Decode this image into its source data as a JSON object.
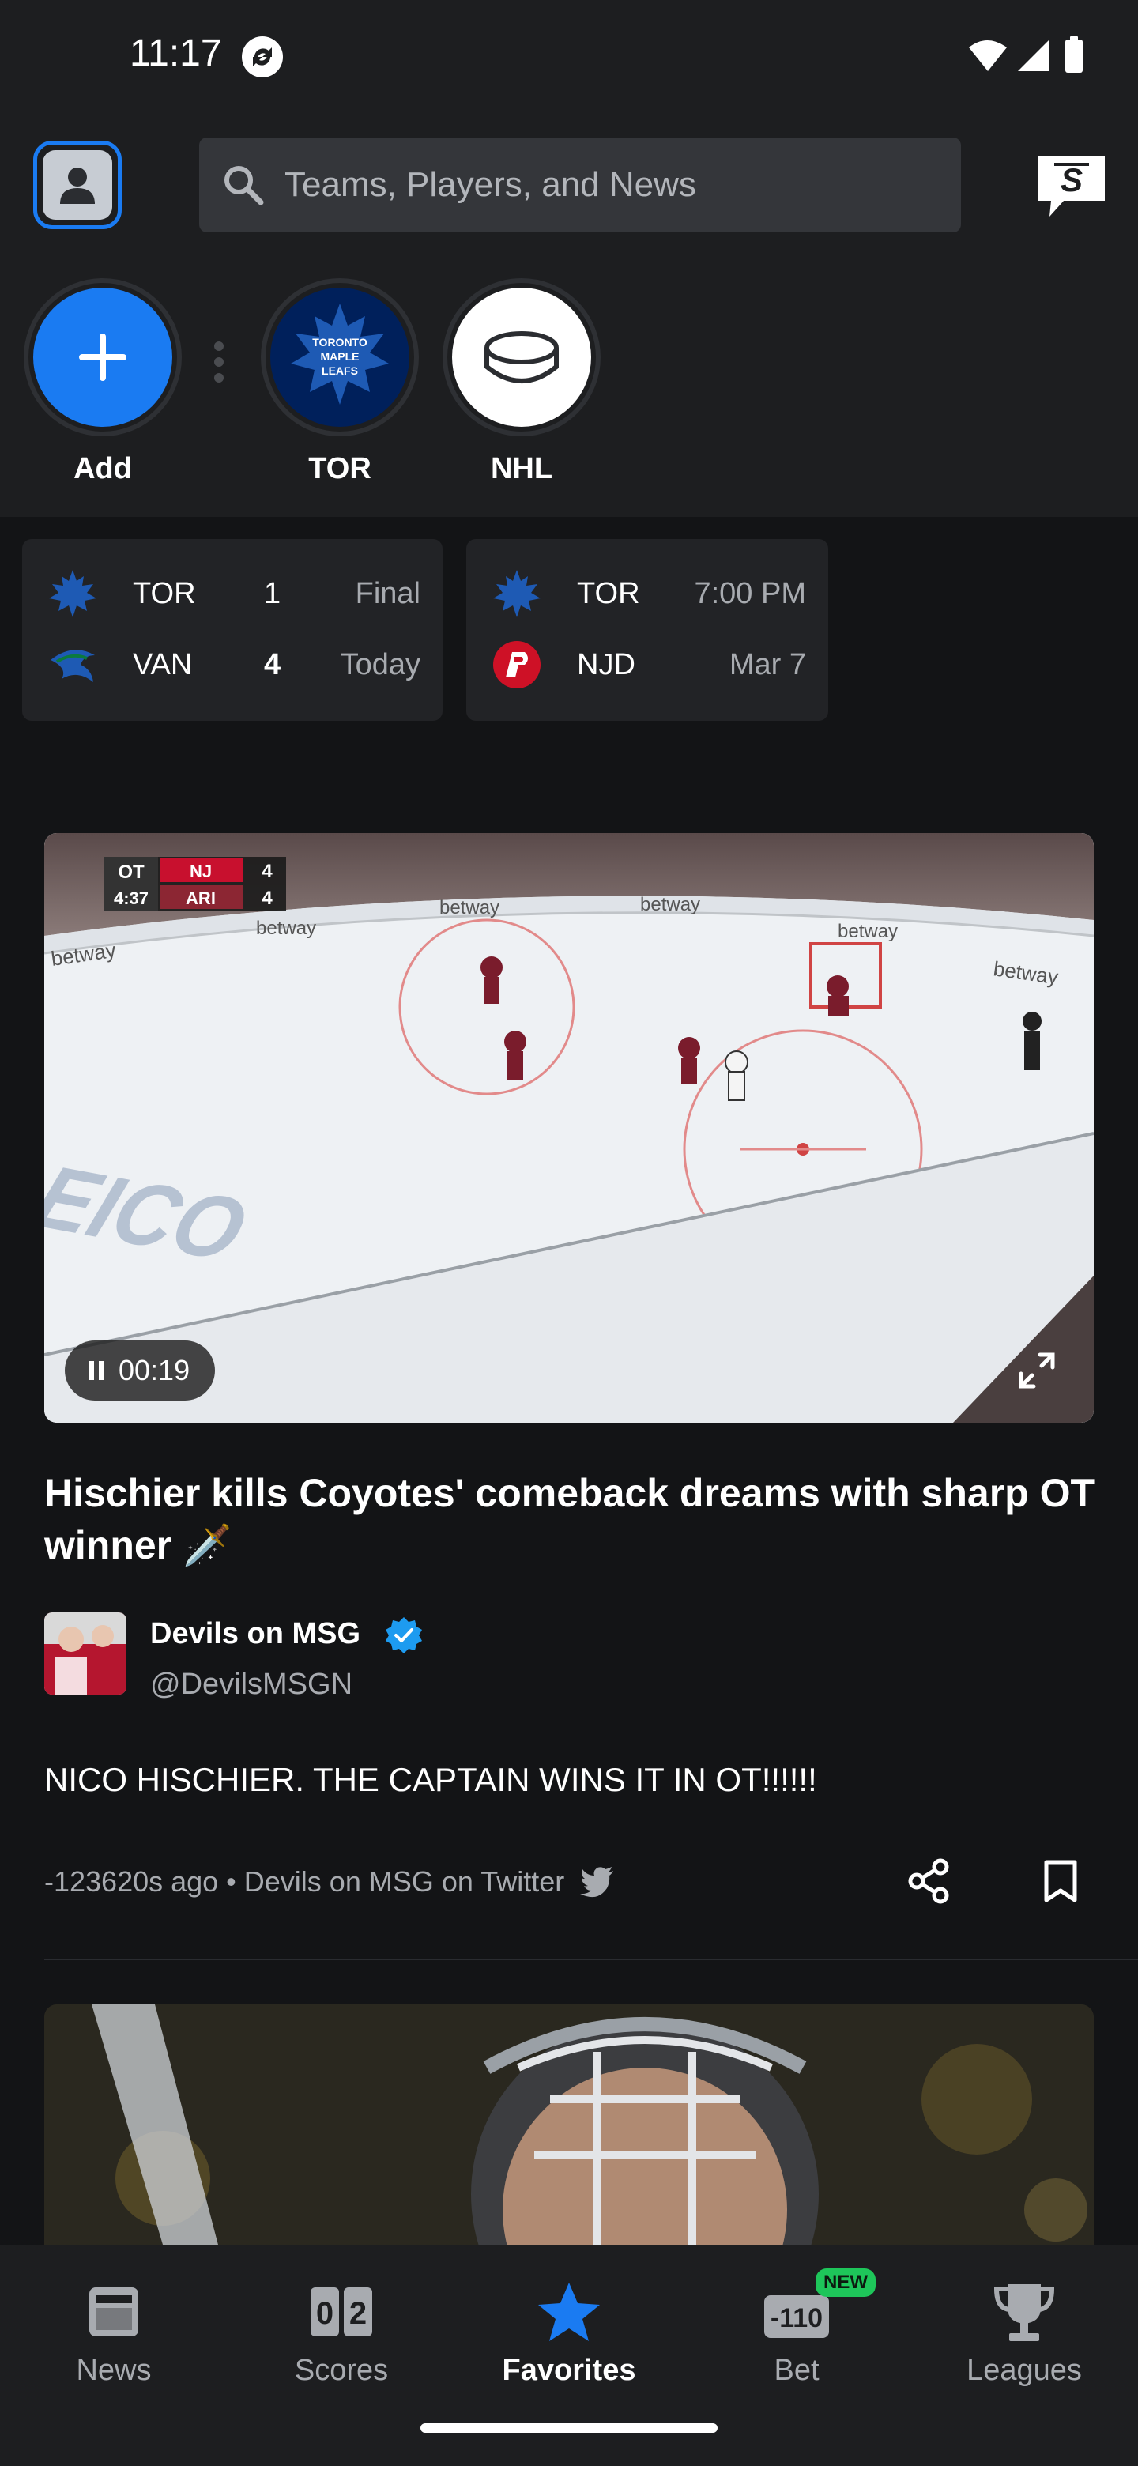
{
  "status_bar": {
    "time": "11:17"
  },
  "header": {
    "search_placeholder": "Teams, Players, and News"
  },
  "favorites": [
    {
      "label": "Add",
      "icon": "plus-icon",
      "color": "#1a7bf2"
    },
    {
      "label": "TOR",
      "icon": "maple-leafs-logo",
      "color": "#00205b"
    },
    {
      "label": "NHL",
      "icon": "hockey-puck-icon",
      "color": "#ffffff"
    }
  ],
  "games": [
    {
      "home": {
        "team": "TOR",
        "score": "1",
        "status": "Final",
        "logo": "maple-leafs-logo"
      },
      "away": {
        "team": "VAN",
        "score": "4",
        "status": "Today",
        "logo": "canucks-logo"
      }
    },
    {
      "home": {
        "team": "TOR",
        "status": "7:00 PM",
        "logo": "maple-leafs-logo"
      },
      "away": {
        "team": "NJD",
        "status": "Mar 7",
        "logo": "devils-logo"
      }
    }
  ],
  "article": {
    "video_time": "00:19",
    "headline": "Hischier kills Coyotes' comeback dreams with sharp OT winner 🗡️",
    "author_name": "Devils on MSG",
    "author_handle": "@DevilsMSGN",
    "body": "NICO HISCHIER. THE CAPTAIN WINS IT IN OT!!!!!!",
    "meta": "-123620s ago • Devils on MSG on Twitter",
    "scorebug": {
      "period": "OT",
      "clock": "4:37",
      "teams": [
        {
          "abbr": "NJ",
          "score": "4"
        },
        {
          "abbr": "ARI",
          "score": "4"
        }
      ]
    }
  },
  "bottom_nav": [
    {
      "label": "News",
      "icon": "news-icon",
      "active": false
    },
    {
      "label": "Scores",
      "icon": "scores-icon",
      "active": false,
      "digits": [
        "0",
        "2"
      ]
    },
    {
      "label": "Favorites",
      "icon": "star-icon",
      "active": true
    },
    {
      "label": "Bet",
      "icon": "bet-icon",
      "active": false,
      "badge": "NEW",
      "odds": "-110"
    },
    {
      "label": "Leagues",
      "icon": "trophy-icon",
      "active": false
    }
  ],
  "colors": {
    "accent": "#1a7bf2",
    "background": "#131416",
    "surface": "#1d1e20",
    "card": "#222326"
  }
}
